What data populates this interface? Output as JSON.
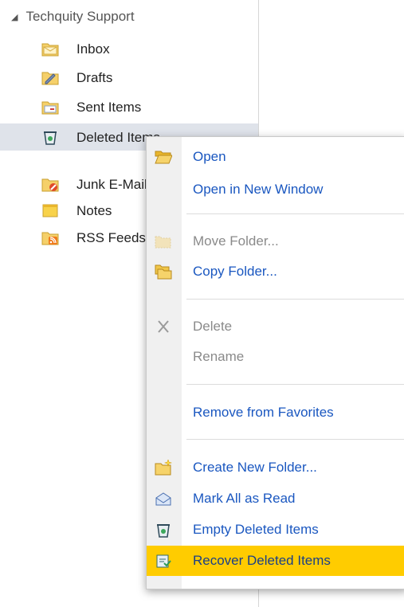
{
  "tree": {
    "account": "Techquity Support",
    "folders": [
      {
        "label": "Inbox",
        "icon": "inbox-folder-icon"
      },
      {
        "label": "Drafts",
        "icon": "drafts-folder-icon"
      },
      {
        "label": "Sent Items",
        "icon": "sent-items-folder-icon"
      },
      {
        "label": "Deleted Items",
        "icon": "deleted-items-folder-icon",
        "selected": true
      },
      {
        "label": "Junk E-Mail",
        "icon": "junk-email-folder-icon"
      },
      {
        "label": "Notes",
        "icon": "notes-folder-icon"
      },
      {
        "label": "RSS Feeds",
        "icon": "rss-feeds-folder-icon"
      }
    ]
  },
  "menu": {
    "items": [
      {
        "label": "Open",
        "icon": "open-folder-icon",
        "enabled": true
      },
      {
        "label": "Open in New Window",
        "icon": "",
        "enabled": true
      },
      {
        "label": "Move Folder...",
        "icon": "move-folder-icon",
        "enabled": false
      },
      {
        "label": "Copy Folder...",
        "icon": "copy-folder-icon",
        "enabled": true
      },
      {
        "label": "Delete",
        "icon": "delete-x-icon",
        "enabled": false
      },
      {
        "label": "Rename",
        "icon": "",
        "enabled": false
      },
      {
        "label": "Remove from Favorites",
        "icon": "",
        "enabled": true
      },
      {
        "label": "Create New Folder...",
        "icon": "new-folder-icon",
        "enabled": true
      },
      {
        "label": "Mark All as Read",
        "icon": "mark-read-envelope-icon",
        "enabled": true
      },
      {
        "label": "Empty Deleted Items",
        "icon": "empty-trash-icon",
        "enabled": true
      },
      {
        "label": "Recover Deleted Items",
        "icon": "recover-items-icon",
        "enabled": true,
        "highlighted": true
      }
    ]
  },
  "colors": {
    "menu_text": "#1a57c0",
    "disabled_text": "#8a8a8a",
    "highlight": "#ffcc00",
    "selected_row": "#dfe3ea"
  }
}
